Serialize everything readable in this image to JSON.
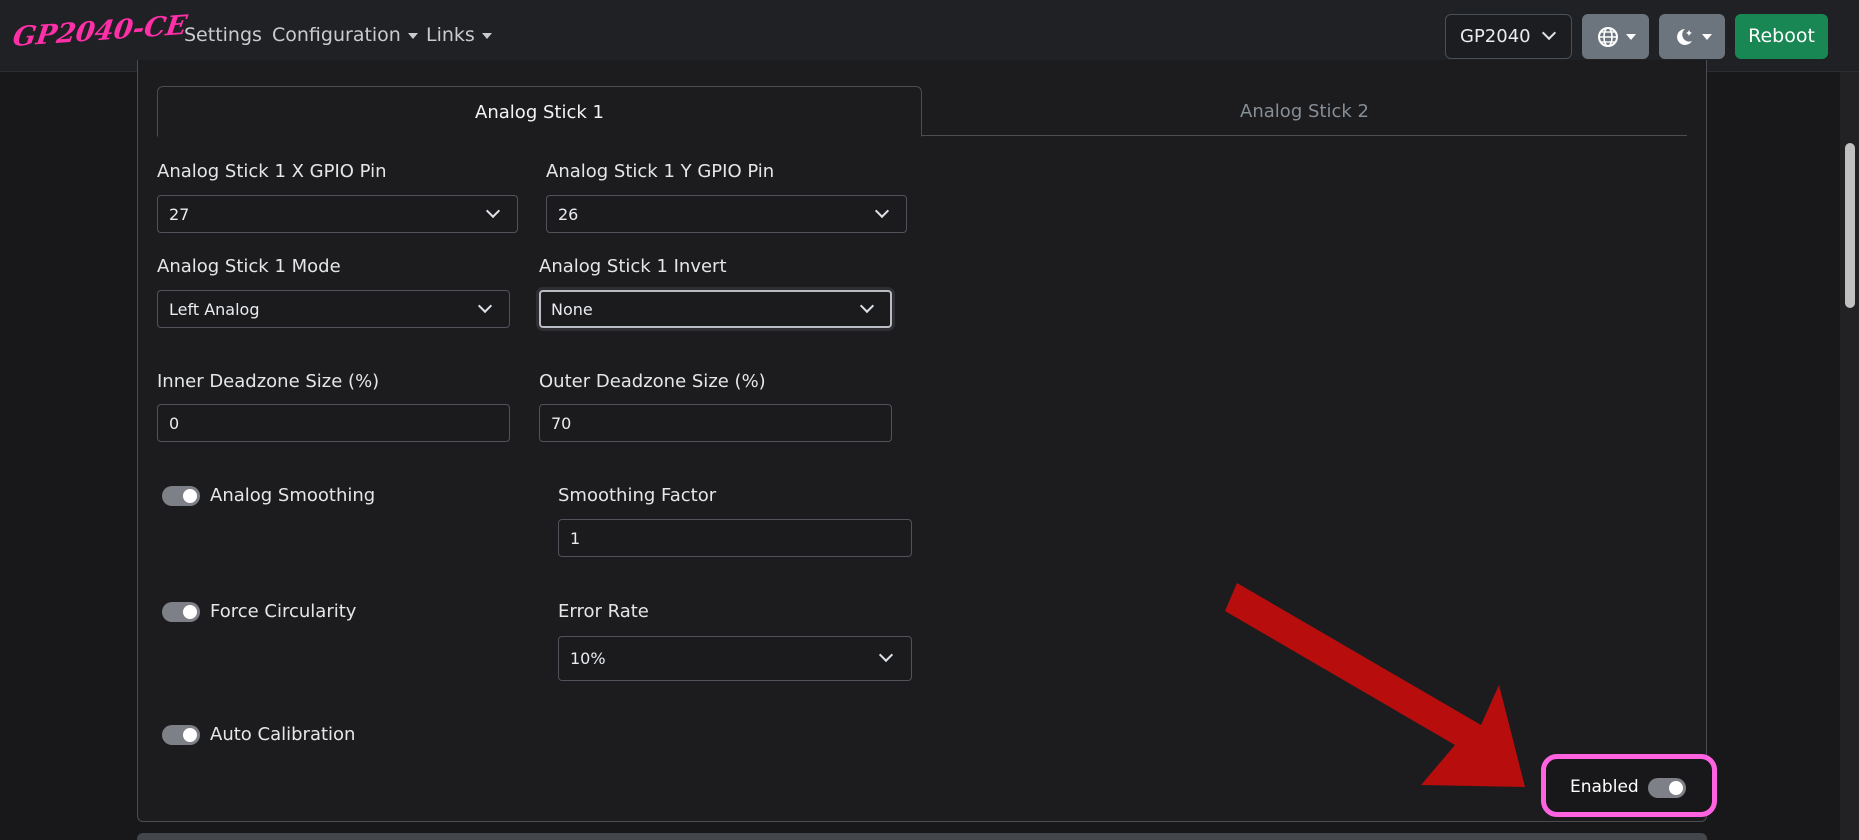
{
  "navbar": {
    "brand": "GP2040-CE",
    "links": [
      {
        "label": "Settings"
      },
      {
        "label": "Configuration"
      },
      {
        "label": "Links"
      }
    ],
    "board_select": "GP2040",
    "reboot_label": "Reboot",
    "language_icon": "globe-icon",
    "theme_icon": "moon-stars-icon"
  },
  "tabs": [
    {
      "label": "Analog Stick 1",
      "active": true
    },
    {
      "label": "Analog Stick 2",
      "active": false
    }
  ],
  "form": {
    "x_pin": {
      "label": "Analog Stick 1 X GPIO Pin",
      "value": "27"
    },
    "y_pin": {
      "label": "Analog Stick 1 Y GPIO Pin",
      "value": "26"
    },
    "mode": {
      "label": "Analog Stick 1 Mode",
      "value": "Left Analog"
    },
    "invert": {
      "label": "Analog Stick 1 Invert",
      "value": "None"
    },
    "inner_deadzone": {
      "label": "Inner Deadzone Size (%)",
      "value": "0"
    },
    "outer_deadzone": {
      "label": "Outer Deadzone Size (%)",
      "value": "70"
    },
    "analog_smoothing": {
      "label": "Analog Smoothing",
      "on": true
    },
    "smoothing_factor": {
      "label": "Smoothing Factor",
      "value": "1"
    },
    "force_circularity": {
      "label": "Force Circularity",
      "on": true
    },
    "error_rate": {
      "label": "Error Rate",
      "value": "10%"
    },
    "auto_calibration": {
      "label": "Auto Calibration",
      "on": true
    }
  },
  "enabled_toggle": {
    "label": "Enabled",
    "on": true
  },
  "colors": {
    "brand": "#ff2fa8",
    "reboot": "#198754",
    "annotation_arrow": "#b70d0d",
    "annotation_box": "#ff63e0"
  }
}
